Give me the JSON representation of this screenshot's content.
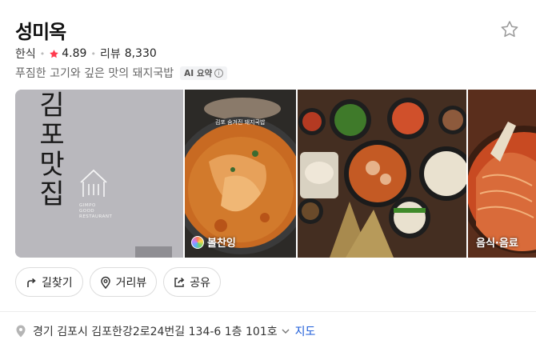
{
  "place": {
    "name": "성미옥",
    "category": "한식",
    "rating": "4.89",
    "review_label": "리뷰",
    "review_count": "8,330",
    "description": "푸짐한 고기와 깊은 맛의 돼지국밥",
    "ai_badge": "AI 요약",
    "info_glyph": "i"
  },
  "photos": {
    "sign_lines": [
      "김",
      "포",
      "맛",
      "집"
    ],
    "sign_small": [
      "GIMPO",
      "GOOD",
      "RESTAURANT"
    ],
    "bowl_caption": "김포 숨겨진 돼지국밥",
    "p2_label": "볼찬잉",
    "p4_label": "음식·음료"
  },
  "actions": {
    "directions": "길찾기",
    "street_view": "거리뷰",
    "share": "공유"
  },
  "address": {
    "text": "경기 김포시 김포한강2로24번길 134-6 1층 101호",
    "map_link": "지도"
  },
  "colors": {
    "rating_star": "#ff3b4e",
    "link": "#1a5ad8",
    "meta_text": "#333333",
    "desc_text": "#666666"
  },
  "icons": [
    "star-outline-icon",
    "star-filled-icon",
    "info-icon",
    "directions-icon",
    "location-pin-icon",
    "share-icon",
    "chevron-down-icon",
    "map-pin-icon"
  ]
}
